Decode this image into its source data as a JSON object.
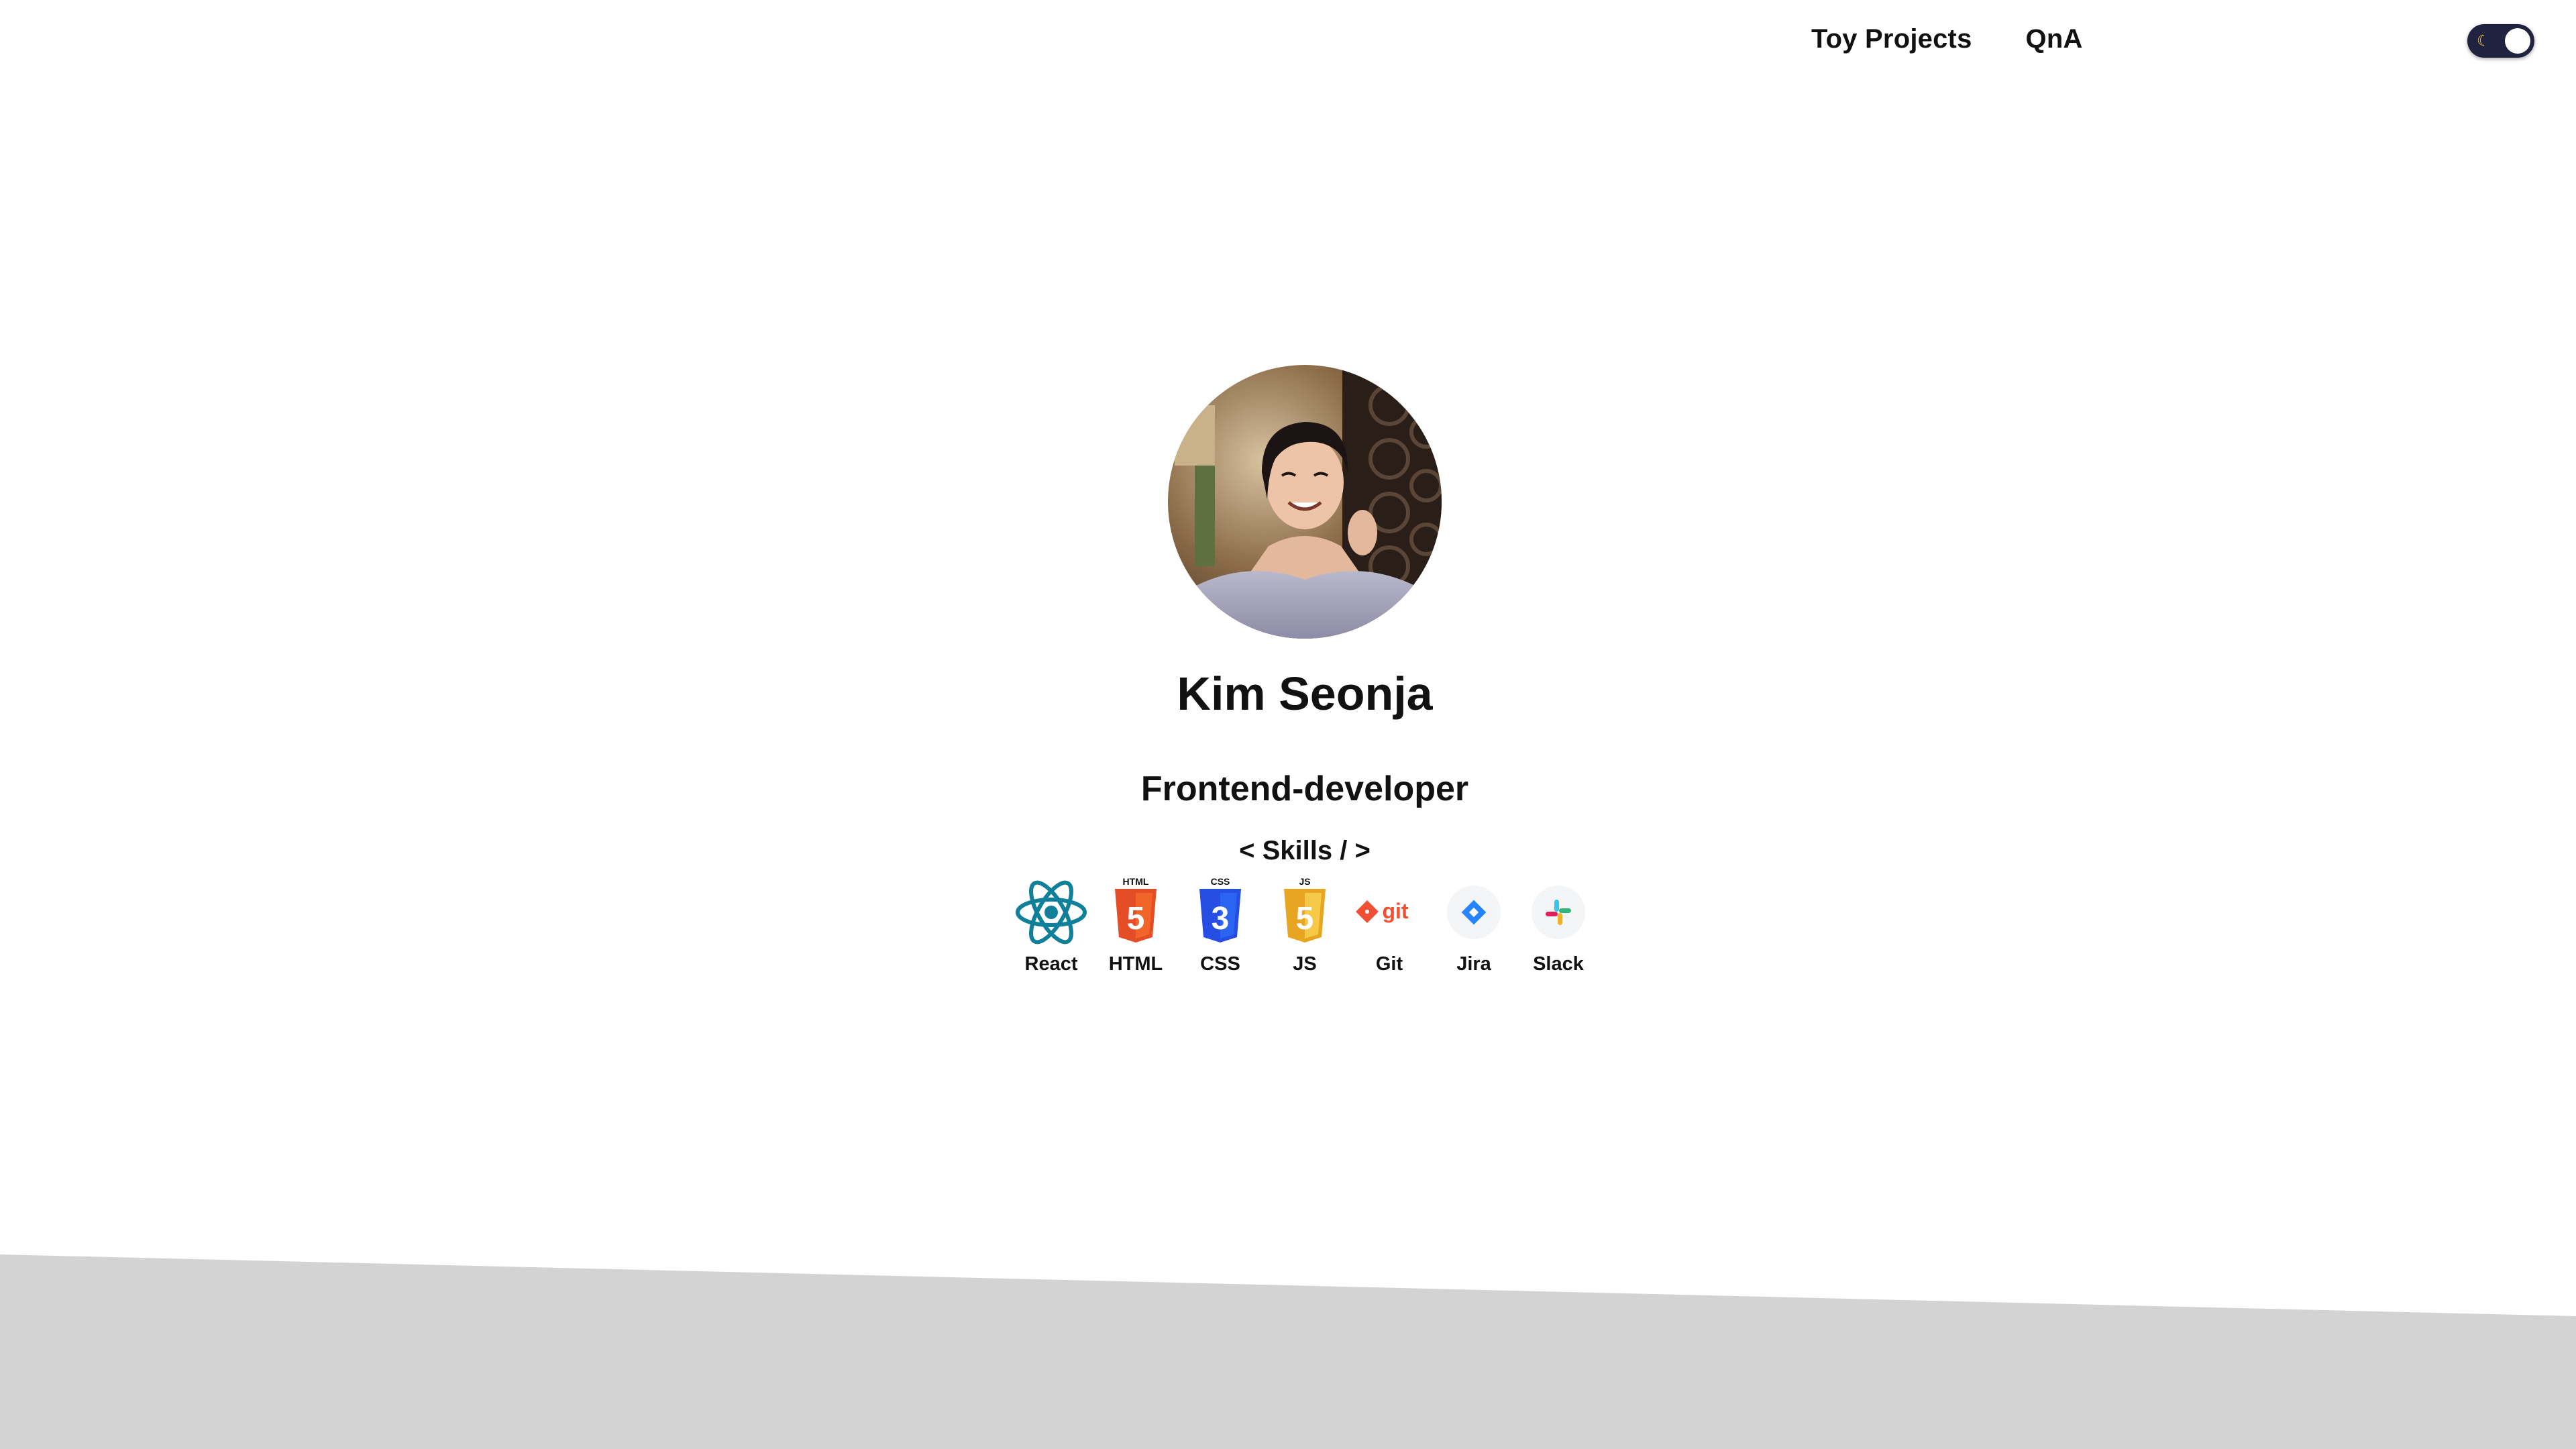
{
  "nav": {
    "items": [
      {
        "label": "Toy Projects"
      },
      {
        "label": "QnA"
      }
    ]
  },
  "theme_toggle": {
    "state": "dark",
    "icon": "moon-icon"
  },
  "profile": {
    "name": "Kim Seonja",
    "role": "Frontend-developer"
  },
  "skills": {
    "title": "< Skills / >",
    "items": [
      {
        "label": "React",
        "icon": "react-icon"
      },
      {
        "label": "HTML",
        "icon": "html5-icon"
      },
      {
        "label": "CSS",
        "icon": "css3-icon"
      },
      {
        "label": "JS",
        "icon": "javascript-icon"
      },
      {
        "label": "Git",
        "icon": "git-icon"
      },
      {
        "label": "Jira",
        "icon": "jira-icon"
      },
      {
        "label": "Slack",
        "icon": "slack-icon"
      }
    ]
  },
  "colors": {
    "background": "#ffffff",
    "footer_band": "#d3d3d3",
    "toggle_bg": "#1f2340",
    "react": "#0f7f9a",
    "html": "#e44d26",
    "css": "#264de4",
    "js": "#f0b429",
    "git": "#f05033",
    "jira": "#2684ff"
  }
}
